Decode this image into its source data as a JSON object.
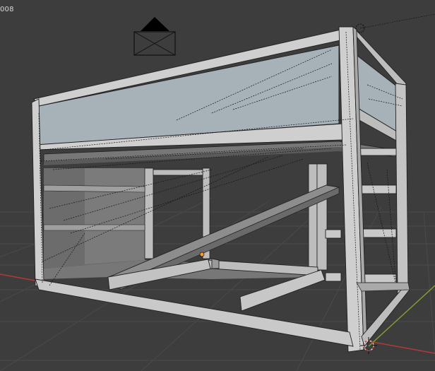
{
  "viewport": {
    "frame_label": "008",
    "background": "#3d3d3d",
    "grid_color": "#4a4a4a",
    "x_axis_color": "#b33a3a",
    "y_axis_color": "#7fa030",
    "frame_color": "#c9c9c9",
    "frame_shade": "#9c9c9c",
    "panel_color": "#a7b2b8",
    "wire_color": "#1a1a1a",
    "origin_color": "#f29b2c"
  },
  "objects": {
    "camera": "camera-icon",
    "bed": "loft-bed-model",
    "ladder": "ladder-model",
    "slide": "slide-ramp-model",
    "origin": "origin-dot",
    "cursor": "3d-cursor-icon"
  }
}
